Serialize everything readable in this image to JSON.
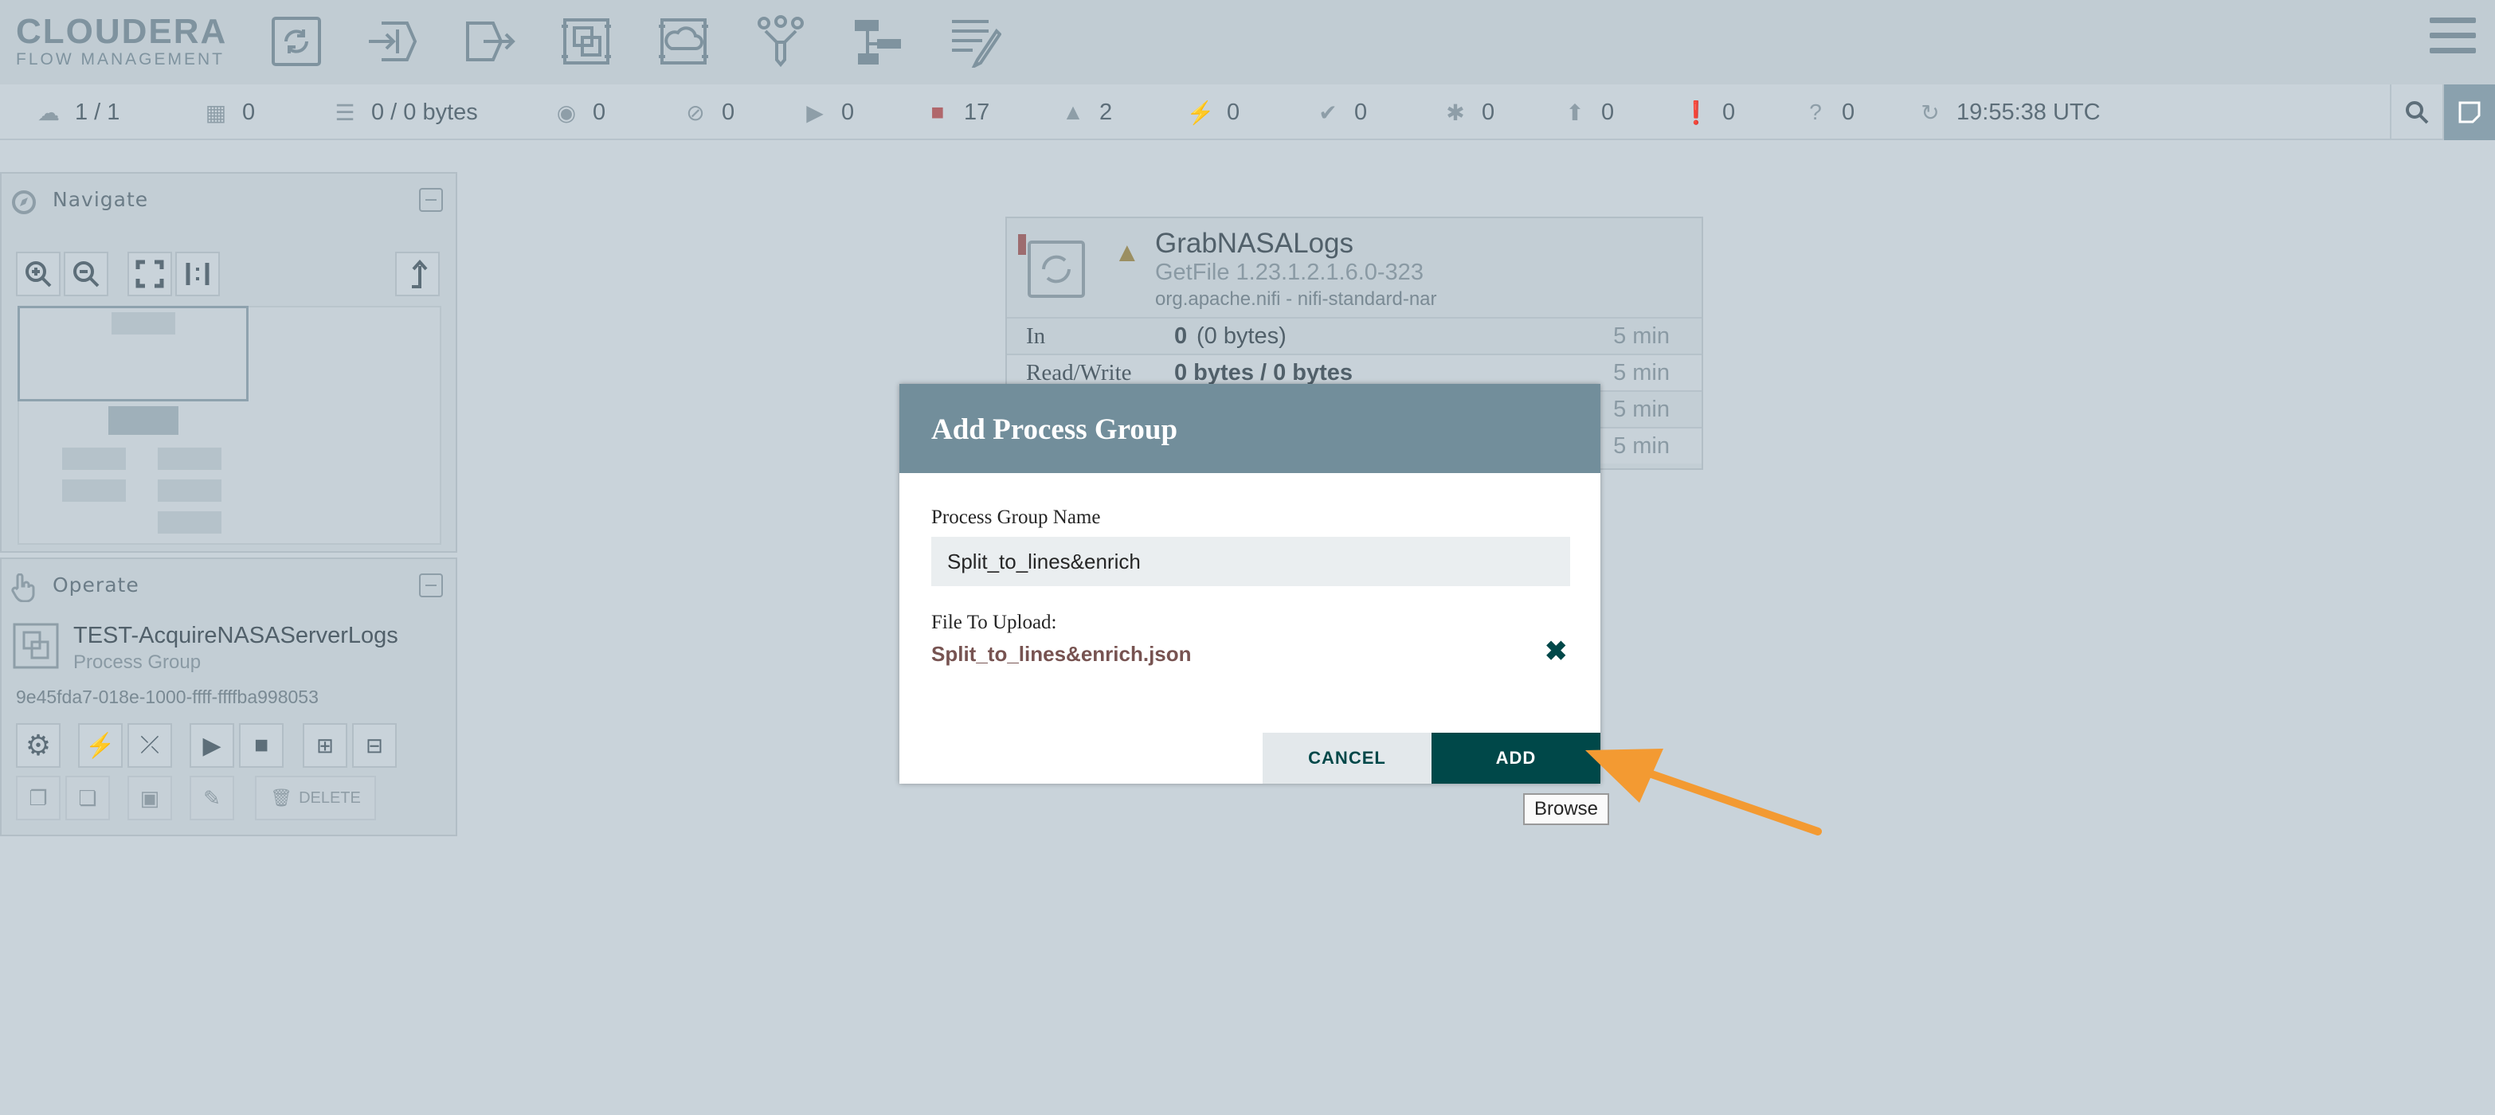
{
  "header": {
    "logo_line1": "CLOUDERA",
    "logo_line2": "FLOW MANAGEMENT",
    "toolbar_icons": [
      "processor-icon",
      "input-port-icon",
      "output-port-icon",
      "process-group-icon",
      "remote-process-group-icon",
      "funnel-icon",
      "template-icon",
      "label-icon"
    ]
  },
  "status": {
    "cluster": "1 / 1",
    "threads": "0",
    "queued": "0 / 0 bytes",
    "transmitting": "0",
    "not_transmitting": "0",
    "running": "0",
    "stopped": "17",
    "invalid": "2",
    "disabled": "0",
    "up_to_date": "0",
    "locally_modified": "0",
    "stale": "0",
    "modified_stale": "0",
    "sync_failure": "0",
    "last_refresh": "19:55:38 UTC"
  },
  "navigate": {
    "title": "Navigate"
  },
  "operate": {
    "title": "Operate",
    "name": "TEST-AcquireNASAServerLogs",
    "type": "Process Group",
    "id": "9e45fda7-018e-1000-ffff-ffffba998053",
    "delete_label": "DELETE"
  },
  "processor": {
    "name": "GrabNASALogs",
    "type": "GetFile 1.23.1.2.1.6.0-323",
    "bundle": "org.apache.nifi - nifi-standard-nar",
    "rows": [
      {
        "label": "In",
        "value": "0",
        "extra": "(0 bytes)",
        "window": "5 min"
      },
      {
        "label": "Read/Write",
        "value": "0 bytes / 0 bytes",
        "extra": "",
        "window": "5 min"
      },
      {
        "label": "",
        "value": "",
        "extra": "",
        "window": "5 min"
      },
      {
        "label": "",
        "value": "",
        "extra": "",
        "window": "5 min"
      }
    ]
  },
  "dialog": {
    "title": "Add Process Group",
    "name_label": "Process Group Name",
    "name_value": "Split_to_lines&enrich",
    "file_label": "File To Upload:",
    "file_name": "Split_to_lines&enrich.json",
    "clear_icon": "✖",
    "cancel_label": "CANCEL",
    "add_label": "ADD"
  },
  "tooltip": {
    "text": "Browse"
  },
  "colors": {
    "accent": "#004849",
    "arrow": "#f39a32",
    "dialog_header": "#728e9b"
  }
}
